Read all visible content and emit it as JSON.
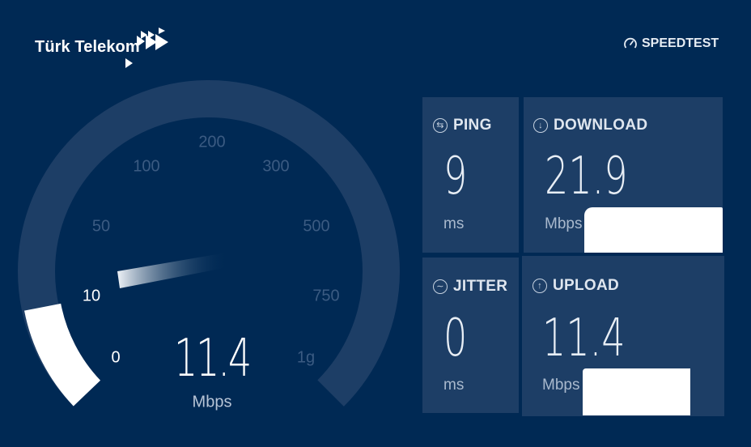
{
  "header": {
    "brand": "Türk Telekom",
    "speedtest_label": "SPEEDTEST"
  },
  "gauge": {
    "current_speed": "11.4",
    "unit": "Mbps",
    "ticks": [
      "0",
      "10",
      "50",
      "100",
      "200",
      "300",
      "500",
      "750",
      "1g"
    ],
    "active_ticks": [
      "0",
      "10"
    ],
    "progress_mbps": 11.4
  },
  "results": {
    "ping": {
      "label": "PING",
      "value": "9",
      "unit": "ms",
      "icon": "ping-icon"
    },
    "download": {
      "label": "DOWNLOAD",
      "value": "21.9",
      "unit": "Mbps",
      "icon": "download-arrow-icon"
    },
    "jitter": {
      "label": "JITTER",
      "value": "0",
      "unit": "ms",
      "icon": "jitter-wave-icon"
    },
    "upload": {
      "label": "UPLOAD",
      "value": "11.4",
      "unit": "Mbps",
      "icon": "upload-arrow-icon"
    }
  },
  "colors": {
    "background": "#002954",
    "tile": "#1d3e66",
    "gauge_track": "#1d3e66",
    "gauge_fill": "#ffffff"
  }
}
